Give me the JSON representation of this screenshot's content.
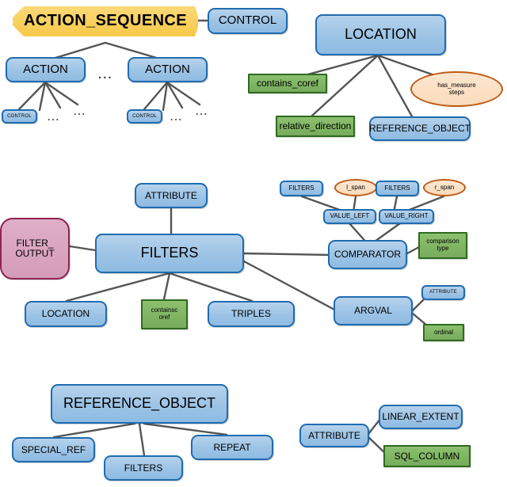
{
  "diagram": {
    "title": "Action-tree grammar node diagram",
    "colors": {
      "blue_fill": "#9cc3e5",
      "blue_stroke": "#1f6cb0",
      "green_fill": "#7fb069",
      "green_stroke": "#2e6b1f",
      "gold_fill": "#f7c948",
      "pink_fill": "#d49cb8",
      "pink_stroke": "#8e2353",
      "oval_fill": "#fbe0c4",
      "oval_stroke": "#c05a16",
      "edge": "#555555",
      "background": "#ffffff"
    },
    "ellipsis_glyph": "..."
  },
  "groups": {
    "action_sequence": {
      "root": "ACTION_SEQUENCE",
      "root_sibling": "CONTROL",
      "child_left": "ACTION",
      "child_right": "ACTION",
      "leaf_left": "CONTROL",
      "leaf_right": "CONTROL"
    },
    "location": {
      "root": "LOCATION",
      "contains_coref": "contains_coref",
      "relative_direction": "relative_direction",
      "reference_object": "REFERENCE_OBJECT",
      "has_measure": "has_measure\nsteps"
    },
    "filters": {
      "root": "FILTERS",
      "attribute": "ATTRIBUTE",
      "filter_output": "FILTER_\nOUTPUT",
      "location": "LOCATION",
      "contains_coref": "containsc\noref",
      "triples": "TRIPLES",
      "comparator": "COMPARATOR",
      "comparison_type": "comparison\ntype",
      "value_left": "VALUE_LEFT",
      "value_right": "VALUE_RIGHT",
      "filters_left": "FILTERS",
      "filters_right": "FILTERS",
      "l_span": "l_span",
      "r_span": "r_span",
      "argval": "ARGVAL",
      "argval_attribute": "ATTRIBUTE",
      "ordinal": "ordinal"
    },
    "reference_object": {
      "root": "REFERENCE_OBJECT",
      "special_ref": "SPECIAL_REF",
      "filters": "FILTERS",
      "repeat": "REPEAT"
    },
    "attribute": {
      "root": "ATTRIBUTE",
      "linear_extent": "LINEAR_EXTENT",
      "sql_column": "SQL_COLUMN"
    }
  }
}
